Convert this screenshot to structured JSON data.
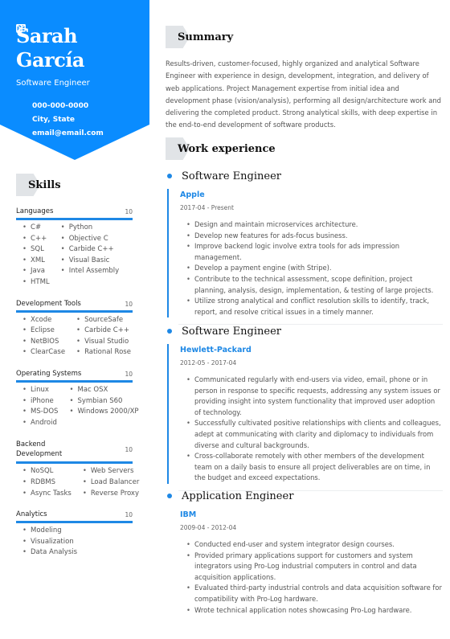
{
  "header": {
    "name": "Sarah García",
    "role": "Software Engineer",
    "phone": "000-000-0000",
    "location": "City, State",
    "email": "email@email.com",
    "accent_color": "#0a8cff"
  },
  "skills": {
    "title": "Skills",
    "groups": [
      {
        "name": "Languages",
        "level": "10",
        "columns": [
          [
            "C#",
            "C++",
            "SQL",
            "XML",
            "Java",
            "HTML"
          ],
          [
            "Python",
            "Objective C",
            "Carbide C++",
            "Visual Basic",
            "Intel Assembly"
          ]
        ]
      },
      {
        "name": "Development Tools",
        "level": "10",
        "columns": [
          [
            "Xcode",
            "Eclipse",
            "NetBIOS",
            "ClearCase"
          ],
          [
            "SourceSafe",
            "Carbide C++",
            "Visual Studio",
            "Rational Rose"
          ]
        ]
      },
      {
        "name": "Operating Systems",
        "level": "10",
        "columns": [
          [
            "Linux",
            "iPhone",
            "MS-DOS",
            "Android"
          ],
          [
            "Mac OSX",
            "Symbian S60",
            "Windows 2000/XP"
          ]
        ]
      },
      {
        "name": "Backend Development",
        "level": "10",
        "columns": [
          [
            "NoSQL",
            "RDBMS",
            "Async Tasks"
          ],
          [
            "Web Servers",
            "Load Balancer",
            "Reverse Proxy"
          ]
        ]
      },
      {
        "name": "Analytics",
        "level": "10",
        "columns": [
          [
            "Modeling",
            "Visualization",
            "Data Analysis"
          ]
        ]
      }
    ]
  },
  "summary": {
    "title": "Summary",
    "text": "Results-driven, customer-focused, highly organized and analytical Software Engineer with experience in design, development, integration, and delivery of web applications. Project Management expertise from initial idea and development phase (vision/analysis), performing all design/architecture work and delivering the completed product. Strong analytical skills, with deep expertise in the end-to-end development of software products."
  },
  "work": {
    "title": "Work experience",
    "jobs": [
      {
        "title": "Software Engineer",
        "company": "Apple",
        "dates": "2017-04 - Present",
        "bullets": [
          "Design and maintain microservices architecture.",
          "Develop new features for ads-focus business.",
          "Improve backend logic involve extra tools for ads impression management.",
          "Develop a payment engine (with Stripe).",
          "Contribute to the technical assessment, scope definition, project planning, analysis, design, implementation, & testing of large projects.",
          "Utilize strong analytical and conflict resolution skills to identify, track, report, and resolve critical issues in a timely manner."
        ]
      },
      {
        "title": "Software Engineer",
        "company": "Hewlett-Packard",
        "dates": "2012-05 - 2017-04",
        "bullets": [
          "Communicated regularly with end-users via video, email, phone or in person in response to specific requests, addressing any system issues or providing insight into system functionality that improved user adoption of technology.",
          "Successfully cultivated positive relationships with clients and colleagues, adept at communicating with clarity and diplomacy to individuals from diverse and cultural backgrounds.",
          "Cross-collaborate remotely with other members of the development team on a daily basis to ensure all project deliverables are on time, in the budget and exceed expectations."
        ]
      },
      {
        "title": "Application Engineer",
        "company": "IBM",
        "dates": "2009-04 - 2012-04",
        "bullets": [
          "Conducted end-user and system integrator design courses.",
          "Provided primary applications support for customers and system integrators using Pro-Log industrial computers in control and data acquisition applications.",
          "Evaluated third-party industrial controls and data acquisition software for compatibility with Pro-Log hardware.",
          "Wrote technical application notes showcasing Pro-Log hardware."
        ]
      }
    ]
  }
}
